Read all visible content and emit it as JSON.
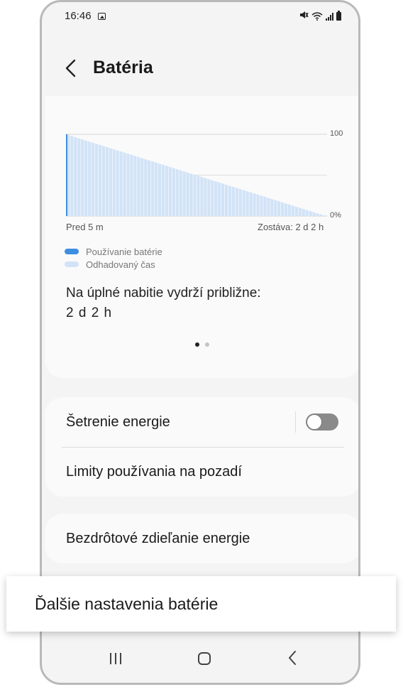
{
  "status_bar": {
    "time": "16:46",
    "icons": [
      "image-icon",
      "mute-icon",
      "wifi-icon",
      "signal-icon",
      "battery-icon"
    ]
  },
  "header": {
    "title": "Batéria",
    "back_icon": "chevron-left-icon"
  },
  "battery_card": {
    "full_charge_label": "Na úplné nabitie vydrží približne:",
    "full_charge_value": "2 d 2 h",
    "page_indicator": {
      "pages": 2,
      "active": 0
    }
  },
  "chart_data": {
    "type": "area",
    "x_start_label": "Pred 5 m",
    "x_end_label": "Zostáva: 2 d 2 h",
    "y_ticks": [
      "100",
      "0%"
    ],
    "ylim": [
      0,
      100
    ],
    "series": [
      {
        "name": "Používanie batérie",
        "values": [
          100
        ]
      },
      {
        "name": "Odhadovaný čas",
        "values": [
          100,
          0
        ]
      }
    ],
    "colors": {
      "usage": "#3e8ee0",
      "estimated": "#d2e3f7"
    }
  },
  "settings": {
    "group1": {
      "power_saving_label": "Šetrenie energie",
      "power_saving_enabled": false,
      "background_limits_label": "Limity používania na pozadí"
    },
    "group2": {
      "wireless_sharing_label": "Bezdrôtové zdieľanie energie"
    },
    "callout_label": "Ďalšie nastavenia batérie"
  },
  "nav_bar": {
    "icons": [
      "recent-apps-icon",
      "home-icon",
      "back-icon"
    ]
  }
}
